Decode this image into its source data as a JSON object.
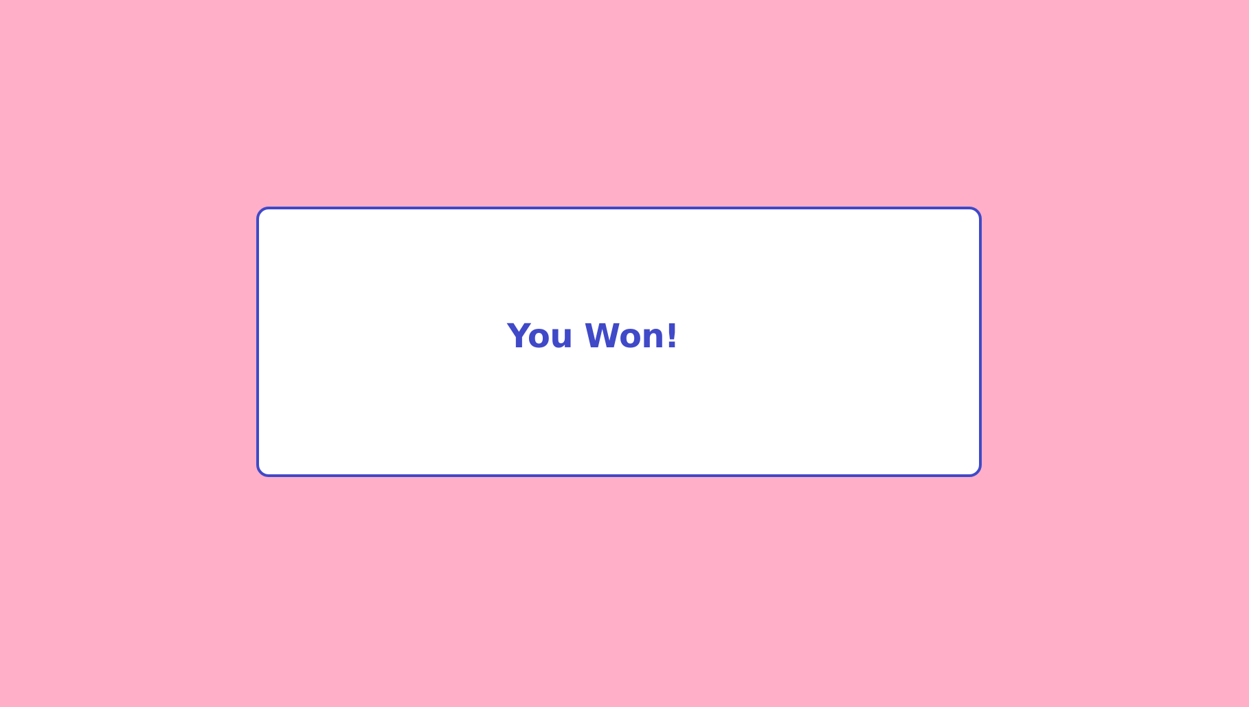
{
  "screen": {
    "background_color": "#ffafc8"
  },
  "dialog": {
    "background_color": "#ffffff",
    "border_color": "#4049c8",
    "message": "You Won!",
    "message_color": "#4049c8"
  }
}
